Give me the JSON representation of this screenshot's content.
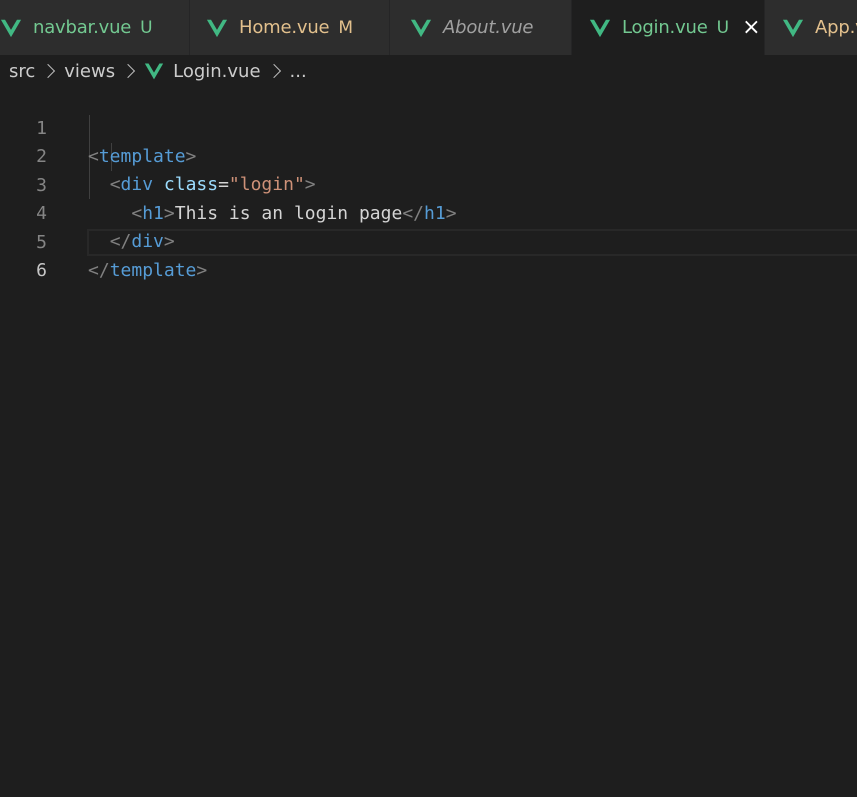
{
  "tabs": [
    {
      "label": "navbar.vue",
      "badge": "U",
      "color": "#73c991",
      "italic": false,
      "active": false
    },
    {
      "label": "Home.vue",
      "badge": "M",
      "color": "#e2c08d",
      "italic": false,
      "active": false
    },
    {
      "label": "About.vue",
      "badge": "",
      "color": "#a0a0a0",
      "italic": true,
      "active": false
    },
    {
      "label": "Login.vue",
      "badge": "U",
      "color": "#73c991",
      "italic": false,
      "active": true,
      "close": "×"
    },
    {
      "label": "App.vue",
      "badge": "",
      "color": "#e2c08d",
      "italic": false,
      "active": false
    }
  ],
  "tab_icon": "vue-icon",
  "breadcrumb": {
    "parts": [
      "src",
      "views",
      "Login.vue",
      "..."
    ]
  },
  "editor": {
    "line_numbers": [
      "1",
      "2",
      "3",
      "4",
      "5",
      "6"
    ],
    "current_line": "6",
    "lines": [
      {
        "open": "<",
        "tag": "template",
        "close": ">"
      },
      {
        "indent": "  ",
        "open": "<",
        "tag": "div",
        "attr": "class",
        "eq": "=",
        "str": "\"login\"",
        "close": ">"
      },
      {
        "indent": "    ",
        "open": "<",
        "tag": "h1",
        "close": ">",
        "text": "This is an login page",
        "open2": "</",
        "tag2": "h1",
        "close2": ">"
      },
      {
        "indent": "  ",
        "open": "</",
        "tag": "div",
        "close": ">"
      },
      {
        "open": "</",
        "tag": "template",
        "close": ">"
      },
      {}
    ]
  },
  "colors": {
    "background": "#1e1e1e",
    "tab_inactive": "#2d2d2d",
    "vue_green": "#41b883",
    "vue_dark": "#35495e",
    "tag": "#569cd6",
    "attribute": "#9cdcfe",
    "string": "#ce9178",
    "punctuation": "#808080"
  }
}
